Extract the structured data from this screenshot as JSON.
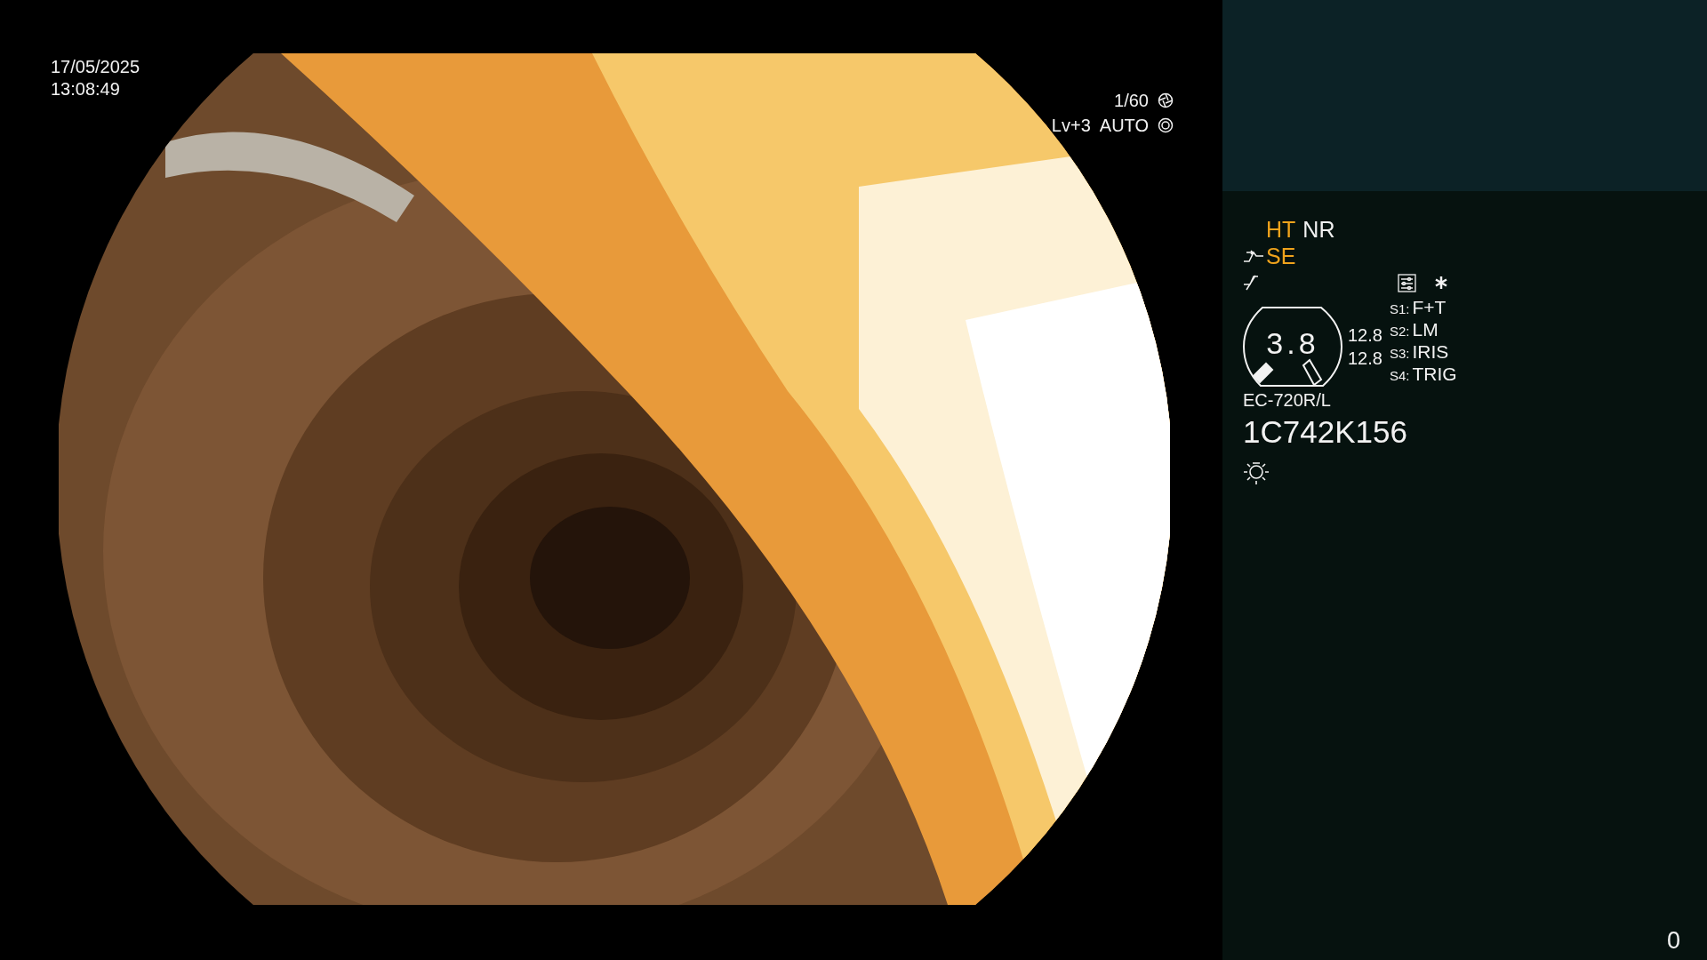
{
  "timestamp": {
    "date": "17/05/2025",
    "time": "13:08:49"
  },
  "exposure": {
    "shutter": "1/60",
    "level": "Lv+3",
    "mode": "AUTO"
  },
  "indicators": [
    {
      "label": "HT",
      "active": true
    },
    {
      "label": "NR",
      "active": false
    }
  ],
  "structure": {
    "label": "SE",
    "active": true
  },
  "gauge": {
    "value": "3.8",
    "readings": [
      "12.8",
      "12.8"
    ]
  },
  "switches": [
    {
      "key": "S1:",
      "function": "F+T"
    },
    {
      "key": "S2:",
      "function": "LM"
    },
    {
      "key": "S3:",
      "function": "IRIS"
    },
    {
      "key": "S4:",
      "function": "TRIG"
    }
  ],
  "scope": {
    "model": "EC-720R/L",
    "serial": "1C742K156"
  },
  "counter": "0"
}
